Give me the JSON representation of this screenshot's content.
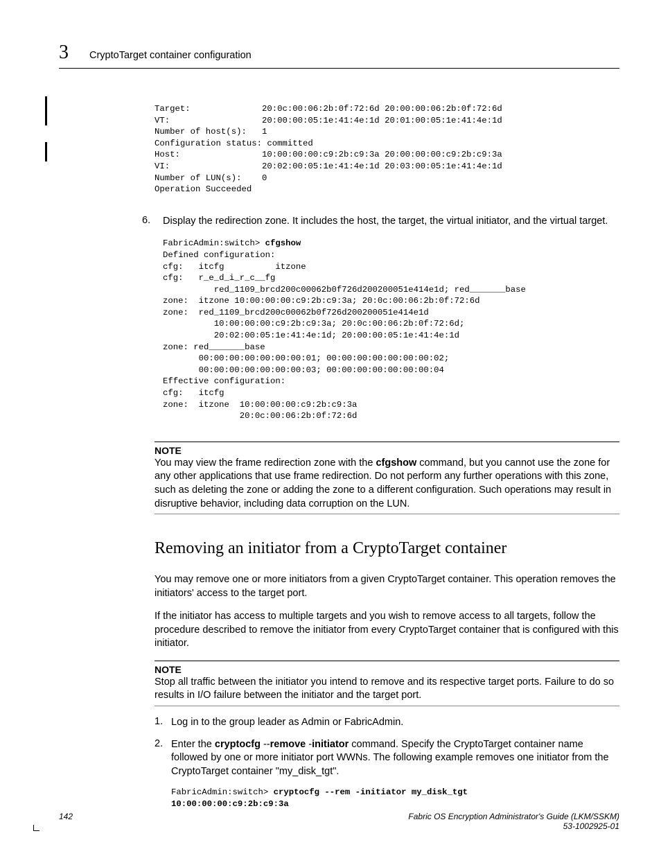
{
  "header": {
    "chapter": "3",
    "title": "CryptoTarget container configuration"
  },
  "code1": {
    "l1": "Target:              20:0c:00:06:2b:0f:72:6d 20:00:00:06:2b:0f:72:6d",
    "l2": "VT:                  20:00:00:05:1e:41:4e:1d 20:01:00:05:1e:41:4e:1d",
    "l3": "Number of host(s):   1",
    "l4": "Configuration status: committed",
    "l5": "Host:                10:00:00:00:c9:2b:c9:3a 20:00:00:00:c9:2b:c9:3a",
    "l6": "VI:                  20:02:00:05:1e:41:4e:1d 20:03:00:05:1e:41:4e:1d",
    "l7": "Number of LUN(s):    0",
    "l8": "Operation Succeeded"
  },
  "step6": {
    "num": "6.",
    "text": "Display the redirection zone. It includes the host, the target, the virtual initiator, and the virtual target."
  },
  "code2": {
    "prompt": "FabricAdmin:switch> ",
    "cmd": "cfgshow",
    "l2": "Defined configuration:",
    "l3": "cfg:   itcfg          itzone",
    "l4": "cfg:   r_e_d_i_r_c__fg",
    "l5": "          red_1109_brcd200c00062b0f726d200200051e414e1d; red_______base",
    "l6": "zone:  itzone 10:00:00:00:c9:2b:c9:3a; 20:0c:00:06:2b:0f:72:6d",
    "l7": "zone:  red_1109_brcd200c00062b0f726d200200051e414e1d",
    "l8": "          10:00:00:00:c9:2b:c9:3a; 20:0c:00:06:2b:0f:72:6d;",
    "l9": "          20:02:00:05:1e:41:4e:1d; 20:00:00:05:1e:41:4e:1d",
    "l10": "zone: red_______base",
    "l11": "       00:00:00:00:00:00:00:01; 00:00:00:00:00:00:00:02;",
    "l12": "       00:00:00:00:00:00:00:03; 00:00:00:00:00:00:00:04",
    "l13": "Effective configuration:",
    "l14": "cfg:   itcfg",
    "l15": "zone:  itzone  10:00:00:00:c9:2b:c9:3a",
    "l16": "               20:0c:00:06:2b:0f:72:6d"
  },
  "note1": {
    "label": "NOTE",
    "p1a": "You may view the frame redirection zone with the ",
    "cmd": "cfgshow",
    "p1b": " command, but you cannot use the zone for any other applications that use frame redirection. Do not perform any further operations with this zone, such as deleting the zone or adding the zone to a different configuration. Such operations may result in disruptive behavior, including data corruption on the LUN."
  },
  "heading": "Removing an initiator from a CryptoTarget container",
  "para1": "You may remove one or more initiators from a given CryptoTarget container. This operation removes the initiators' access to the target port.",
  "para2": "If the initiator has access to multiple targets and you wish to remove access to all targets, follow the procedure described to remove the initiator from every CryptoTarget container that is configured with this initiator.",
  "note2": {
    "label": "NOTE",
    "body": "Stop all traffic between the initiator you intend to remove and its respective target ports. Failure to do so results in I/O failure between the initiator and the target port."
  },
  "steps2": {
    "s1": {
      "num": "1.",
      "text": "Log in to the group leader as Admin or FabricAdmin."
    },
    "s2": {
      "num": "2.",
      "pre": "Enter the ",
      "cmd1": "cryptocfg ",
      "dash1": "--",
      "cmd2": "remove ",
      "dash2": "-",
      "cmd3": "initiator",
      "post": " command. Specify the CryptoTarget container name followed by one or more initiator port WWNs. The following example removes one initiator from the CryptoTarget container \"my_disk_tgt\"."
    }
  },
  "code3": {
    "prompt": "FabricAdmin:switch> ",
    "cmd": "cryptocfg --rem -initiator my_disk_tgt ",
    "l2": "10:00:00:00:c9:2b:c9:3a"
  },
  "footer": {
    "page": "142",
    "title": "Fabric OS Encryption Administrator's Guide  (LKM/SSKM)",
    "docnum": "53-1002925-01"
  }
}
